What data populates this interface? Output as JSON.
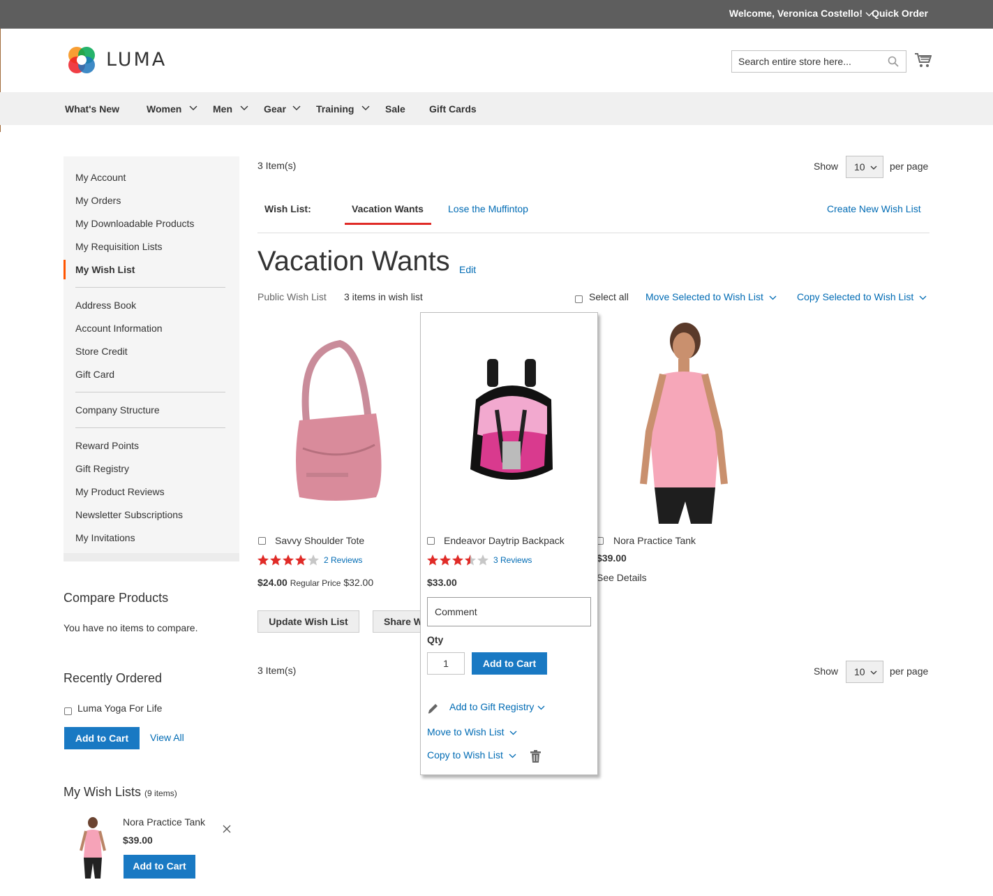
{
  "topbar": {
    "welcome": "Welcome, Veronica Costello!",
    "quick_order": "Quick Order"
  },
  "header": {
    "logo_text": "LUMA",
    "search_placeholder": "Search entire store here..."
  },
  "nav": {
    "items": [
      "What's New",
      "Women",
      "Men",
      "Gear",
      "Training",
      "Sale",
      "Gift Cards"
    ]
  },
  "sidebar": {
    "group1": [
      "My Account",
      "My Orders",
      "My Downloadable Products",
      "My Requisition Lists",
      "My Wish List"
    ],
    "group2": [
      "Address Book",
      "Account Information",
      "Store Credit",
      "Gift Card"
    ],
    "group3": [
      "Company Structure"
    ],
    "group4": [
      "Reward Points",
      "Gift Registry",
      "My Product Reviews",
      "Newsletter Subscriptions",
      "My Invitations"
    ]
  },
  "compare": {
    "title": "Compare Products",
    "empty": "You have no items to compare."
  },
  "recent": {
    "title": "Recently Ordered",
    "item": "Luma Yoga For Life",
    "add_to_cart": "Add to Cart",
    "view_all": "View All"
  },
  "mywishlists": {
    "title": "My Wish Lists",
    "count": "(9 items)",
    "item_name": "Nora Practice Tank",
    "item_price": "$39.00",
    "add_to_cart": "Add to Cart"
  },
  "toolbar": {
    "items_count": "3 Item(s)",
    "show": "Show",
    "limit": "10",
    "per_page": "per page"
  },
  "wishlist_tabs": {
    "label": "Wish List:",
    "active": "Vacation Wants",
    "other": "Lose the Muffintop",
    "create": "Create New Wish List"
  },
  "wishlist": {
    "title": "Vacation Wants",
    "edit": "Edit",
    "visibility": "Public Wish List",
    "count_text": "3 items in wish list",
    "select_all": "Select all",
    "move_selected": "Move Selected to Wish List",
    "copy_selected": "Copy Selected to Wish List",
    "update_button": "Update Wish List",
    "share_button": "Share Wish List"
  },
  "products": [
    {
      "name": "Savvy Shoulder Tote",
      "rating": 4,
      "reviews": "2 Reviews",
      "price": "$24.00",
      "regular_label": "Regular Price",
      "regular_price": "$32.00"
    },
    {
      "name": "Endeavor Daytrip Backpack",
      "rating": 3.5,
      "reviews": "3 Reviews",
      "price": "$33.00"
    },
    {
      "name": "Nora Practice Tank",
      "price": "$39.00",
      "details": "See Details"
    }
  ],
  "popup": {
    "comment_placeholder": "Comment",
    "qty_label": "Qty",
    "qty_value": "1",
    "add_to_cart": "Add to Cart",
    "gift_registry": "Add to Gift Registry",
    "move": "Move to Wish List",
    "copy": "Copy to Wish List"
  },
  "colors": {
    "accent_blue": "#1979c3",
    "link_blue": "#006bb4",
    "tab_red": "#e02b27",
    "star_red": "#e02b27",
    "active_nav": "#ff5501"
  }
}
